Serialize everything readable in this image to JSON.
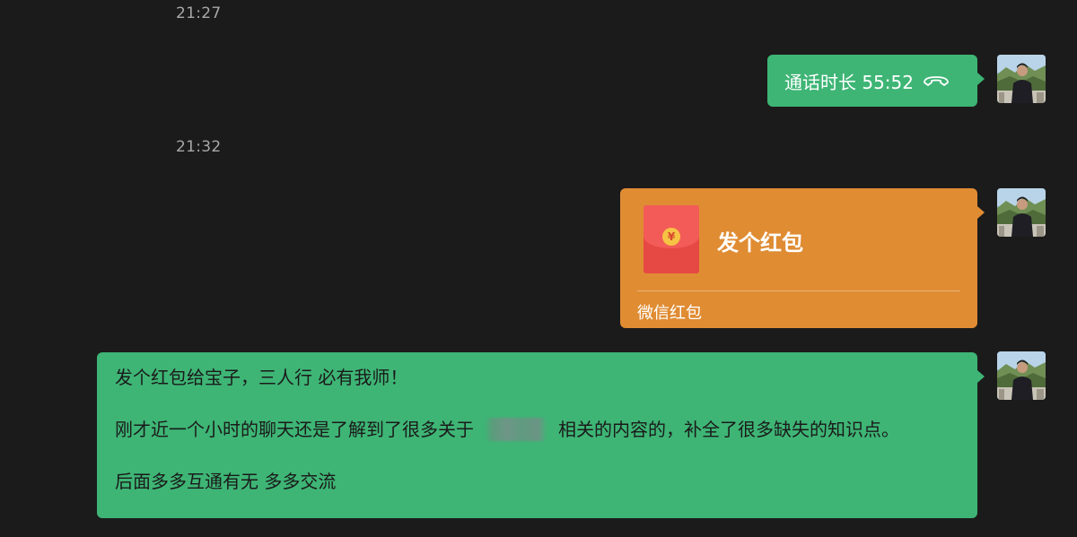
{
  "timestamps": [
    "21:27",
    "21:32"
  ],
  "messages": {
    "call": {
      "text": "通话时长 55:52",
      "icon": "phone-hangup-icon"
    },
    "red_packet": {
      "title": "发个红包",
      "footer": "微信红包",
      "icon": "red-packet-icon"
    },
    "text": {
      "line1": "发个红包给宝子，三人行 必有我师！",
      "line2_before": "刚才近一个小时的聊天还是了解到了很多关于",
      "line2_after": "相关的内容的，补全了很多缺失的知识点。",
      "line3": "后面多多互通有无 多多交流"
    }
  },
  "colors": {
    "background": "#1b1b1b",
    "bubble_green": "#3eb575",
    "bubble_orange": "#e08c33",
    "packet_red": "#e64844",
    "timestamp_text": "#a8a8a8"
  }
}
